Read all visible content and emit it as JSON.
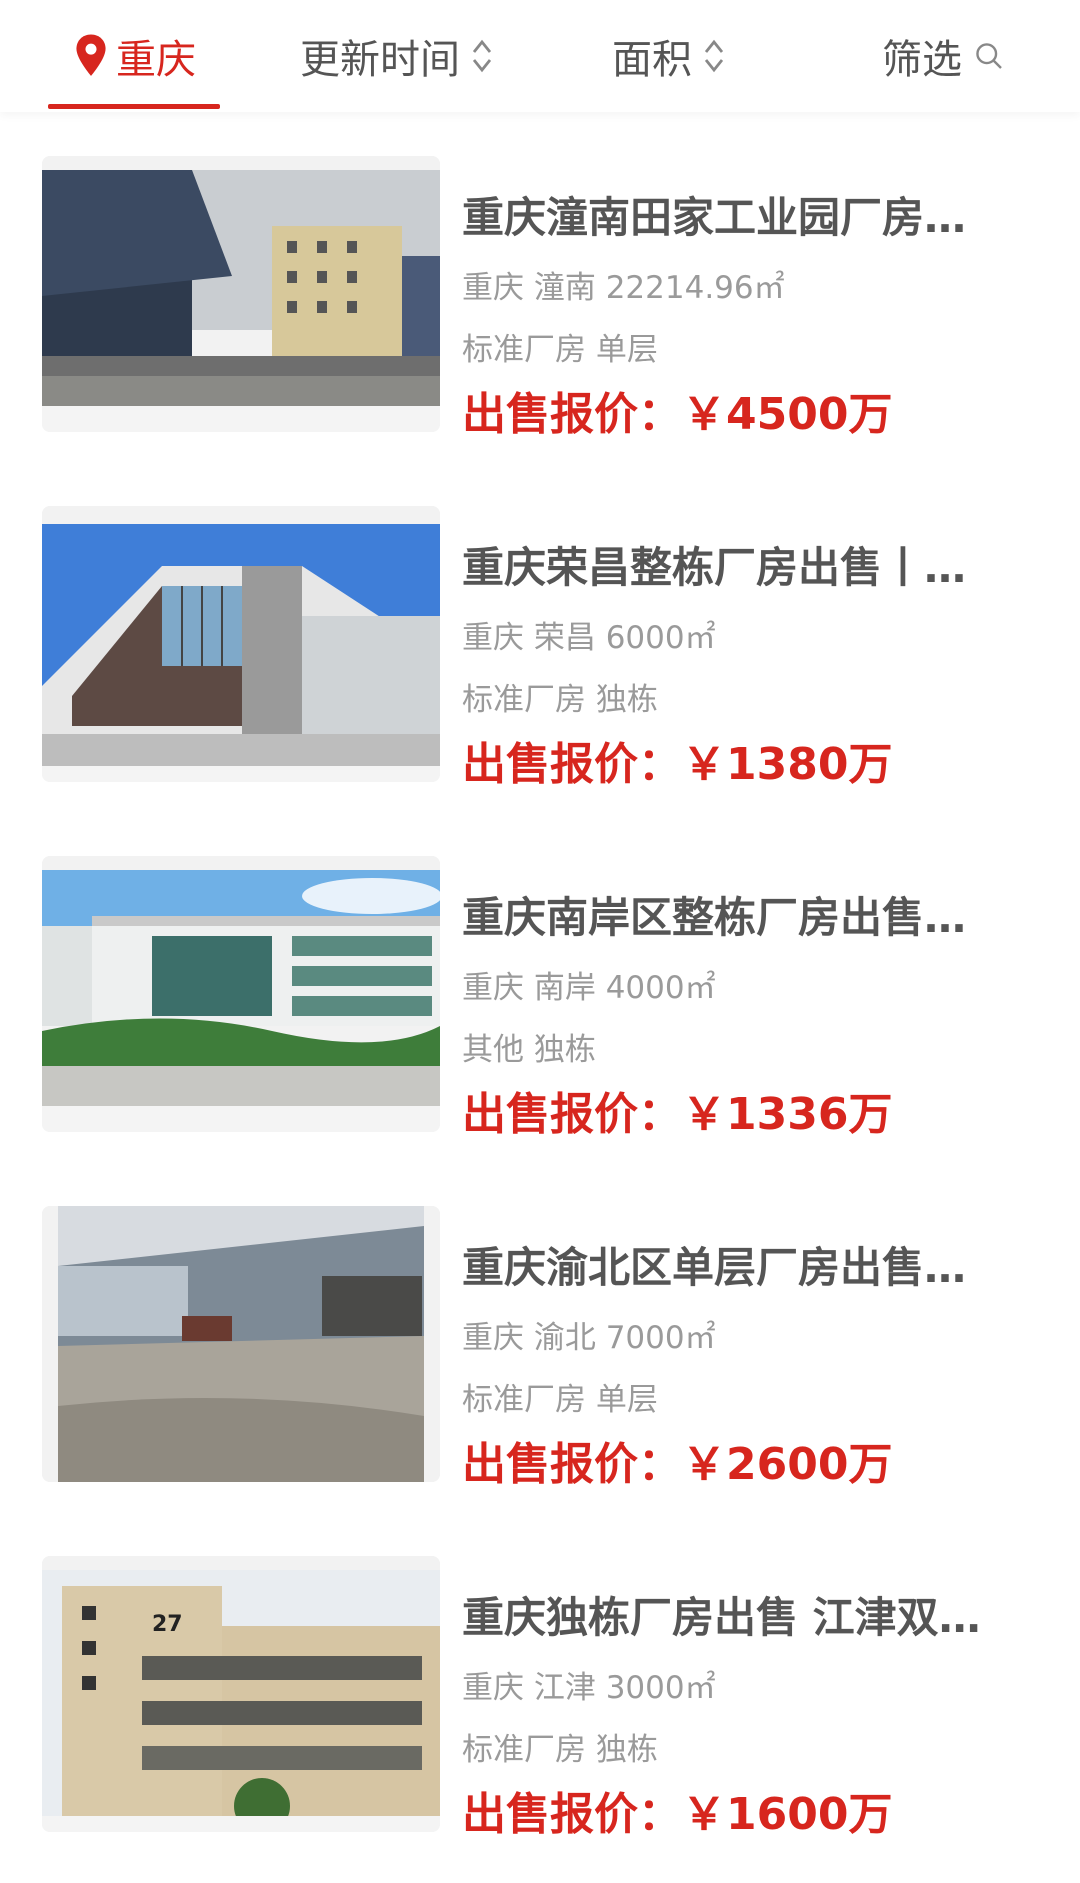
{
  "filters": {
    "city": "重庆",
    "update_time": "更新时间",
    "area": "面积",
    "screen": "筛选"
  },
  "icons": {
    "city": "location-pin-icon",
    "sort": "sort-updown-icon",
    "search": "search-icon"
  },
  "colors": {
    "accent": "#d7261e",
    "muted": "#9a9a9a",
    "title": "#555555"
  },
  "listings": [
    {
      "title": "重庆潼南田家工业园厂房…",
      "meta": "重庆 潼南 22214.96㎡",
      "tags": "标准厂房 单层",
      "price": "出售报价：￥4500万"
    },
    {
      "title": "重庆荣昌整栋厂房出售丨…",
      "meta": "重庆 荣昌 6000㎡",
      "tags": "标准厂房 独栋",
      "price": "出售报价：￥1380万"
    },
    {
      "title": "重庆南岸区整栋厂房出售…",
      "meta": "重庆 南岸 4000㎡",
      "tags": "其他 独栋",
      "price": "出售报价：￥1336万"
    },
    {
      "title": "重庆渝北区单层厂房出售…",
      "meta": "重庆 渝北 7000㎡",
      "tags": "标准厂房 单层",
      "price": "出售报价：￥2600万"
    },
    {
      "title": "重庆独栋厂房出售 江津双…",
      "meta": "重庆 江津 3000㎡",
      "tags": "标准厂房 独栋",
      "price": "出售报价：￥1600万"
    }
  ],
  "photo_labels": {
    "building_number": "27"
  }
}
